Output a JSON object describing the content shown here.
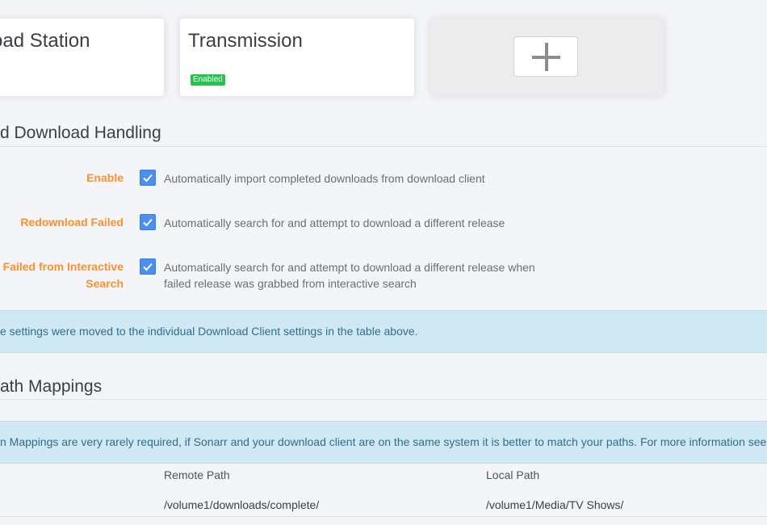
{
  "download_clients": [
    {
      "name": "oad Station"
    },
    {
      "name": "Transmission",
      "status": "Enabled"
    }
  ],
  "add_client": {
    "icon": "plus-icon"
  },
  "completed_handling": {
    "title": "d Download Handling",
    "settings": [
      {
        "label": "Enable",
        "checked": true,
        "help": "Automatically import completed downloads from download client"
      },
      {
        "label": "Redownload Failed",
        "checked": true,
        "help": "Automatically search for and attempt to download a different release"
      },
      {
        "label_line1": "ad Failed from Interactive",
        "label_line2": "Search",
        "checked": true,
        "help": "Automatically search for and attempt to download a different release when failed release was grabbed from interactive search"
      }
    ],
    "info": "e settings were moved to the individual Download Client settings in the table above."
  },
  "remote_path_mappings": {
    "title": "ath Mappings",
    "info": "n Mappings are very rarely required, if Sonarr and your download client are on the same system it is better to match your paths. For more information see the",
    "columns": [
      "Remote Path",
      "Local Path"
    ],
    "rows": [
      {
        "host": "",
        "remote_path": "/volume1/downloads/complete/",
        "local_path": "/volume1/Media/TV Shows/"
      }
    ]
  },
  "colors": {
    "accent_orange": "#ff902b",
    "checkbox_blue": "#4a8ff1",
    "enabled_green": "#27c24c",
    "info_bg": "#d0e8f3"
  }
}
